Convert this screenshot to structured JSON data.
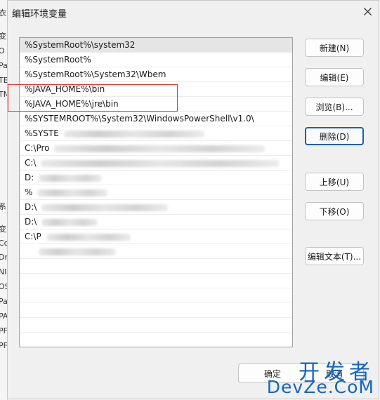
{
  "background_window": {
    "fragments": [
      "衣",
      "变",
      "O",
      "Pa",
      "TE",
      "TM",
      "系",
      "变",
      "Cc",
      "Dr",
      "NI",
      "OS",
      "Pa",
      "PA",
      "PF",
      "PF"
    ]
  },
  "dialog": {
    "title": "编辑环境变量"
  },
  "path_list": {
    "items": [
      {
        "text": "%SystemRoot%\\system32",
        "selected": true
      },
      {
        "text": "%SystemRoot%"
      },
      {
        "text": "%SystemRoot%\\System32\\Wbem"
      },
      {
        "text": "%JAVA_HOME%\\bin"
      },
      {
        "text": "%JAVA_HOME%\\jre\\bin"
      },
      {
        "text": "%SYSTEMROOT%\\System32\\WindowsPowerShell\\v1.0\\"
      },
      {
        "text": "%SYSTE"
      },
      {
        "text": "C:\\Pro"
      },
      {
        "text": "C:\\"
      },
      {
        "text": "D:"
      },
      {
        "text": "%"
      },
      {
        "text": "D:\\"
      },
      {
        "text": "D:\\"
      },
      {
        "text": "C:\\P"
      },
      {
        "text": ""
      }
    ]
  },
  "buttons": {
    "new": "新建(N)",
    "edit": "编辑(E)",
    "browse": "浏览(B)...",
    "delete": "删除(D)",
    "move_up": "上移(U)",
    "move_down": "下移(O)",
    "edit_text": "编辑文本(T)...",
    "ok": "确定",
    "cancel": "取消"
  },
  "watermark": {
    "cn": "开发者",
    "en": "DevZe.CoM"
  },
  "colors": {
    "highlight_border": "#e53935",
    "focus_border": "#1a5fb4",
    "watermark": "#1565c0"
  }
}
